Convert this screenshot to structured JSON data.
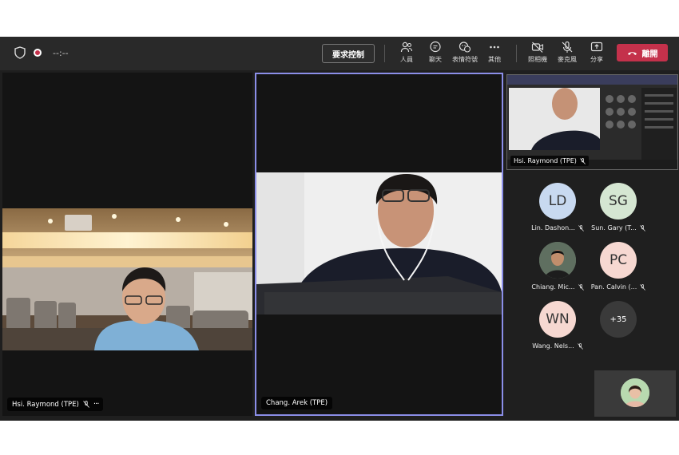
{
  "toolbar": {
    "timer": "--:--",
    "request_control": "要求控制",
    "people": "人員",
    "chat": "聊天",
    "reactions": "表情符號",
    "more": "其他",
    "camera": "照相機",
    "mic": "麥克風",
    "share": "分享",
    "leave": "離開"
  },
  "stage": {
    "tile1_name": "Hsi. Raymond (TPE)",
    "tile2_name": "Chang. Arek (TPE)"
  },
  "sidepanel": {
    "shared_name": "Hsi. Raymond (TPE)",
    "people": [
      {
        "initials": "LD",
        "name": "Lin. Dashon...",
        "color": "#c8d9f0"
      },
      {
        "initials": "SG",
        "name": "Sun. Gary (T...",
        "color": "#d5e6d2"
      },
      {
        "initials": "",
        "name": "Chiang. Mic...",
        "color": "#6b7d6a"
      },
      {
        "initials": "PC",
        "name": "Pan. Calvin (...",
        "color": "#f6d8d1"
      },
      {
        "initials": "WN",
        "name": "Wang. Nels...",
        "color": "#f6d8d1"
      },
      {
        "initials": "+35",
        "name": "",
        "color": "#3a3a3a"
      }
    ]
  },
  "colors": {
    "leave": "#c4314b",
    "active_border": "#8b8ee8"
  }
}
